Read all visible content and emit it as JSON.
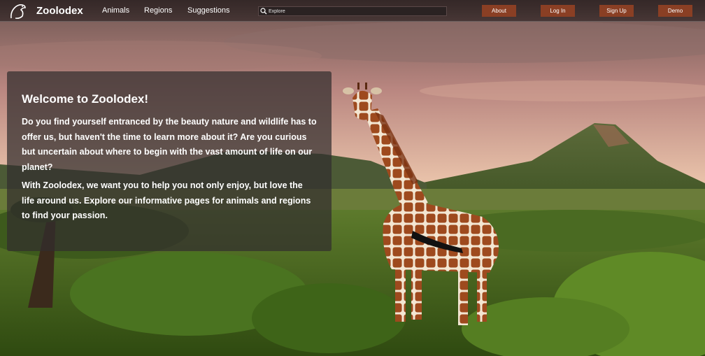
{
  "nav": {
    "brand": "Zoolodex",
    "logo_icon": "dinosaur-logo-icon",
    "links": [
      "Animals",
      "Regions",
      "Suggestions"
    ],
    "search": {
      "placeholder": "Explore",
      "icon": "search-icon"
    },
    "buttons": [
      "About",
      "Log In",
      "Sign Up",
      "Demo"
    ]
  },
  "welcome": {
    "title": "Welcome to Zoolodex!",
    "paragraphs": [
      "Do you find yourself entranced by the beauty nature and wildlife has to offer us, but haven't the time to learn more about it? Are you curious but uncertain about where to begin with the vast amount of life on our planet?",
      "With Zoolodex, we want you to help you not only enjoy, but love the life around us. Explore our informative pages for animals and regions to find your passion."
    ]
  },
  "colors": {
    "nav_bg": "#2e2424",
    "button_bg": "#8a3f24",
    "panel_bg": "#322e2e"
  }
}
